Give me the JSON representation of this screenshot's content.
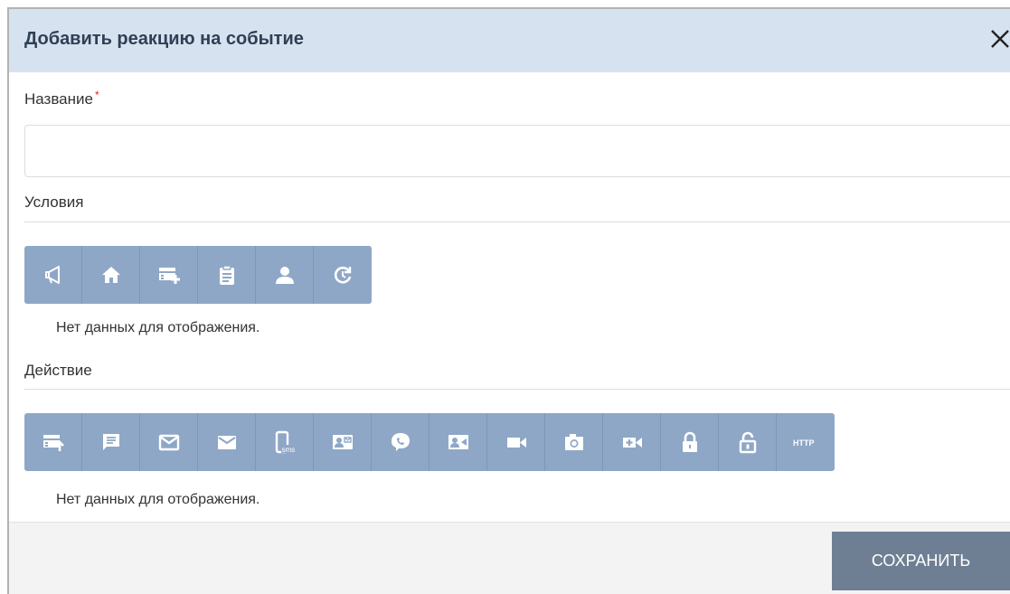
{
  "dialog": {
    "title": "Добавить реакцию на событие",
    "close_icon": "close-icon"
  },
  "form": {
    "name_label": "Название",
    "required_mark": "*",
    "name_value": "",
    "conditions_label": "Условия",
    "conditions_empty": "Нет данных для отображения.",
    "action_label": "Действие",
    "action_empty": "Нет данных для отображения."
  },
  "conditions_toolbar": [
    "megaphone-icon",
    "home-icon",
    "add-card-icon",
    "clipboard-icon",
    "user-icon",
    "schedule-icon"
  ],
  "actions_toolbar": [
    "card-upload-icon",
    "message-icon",
    "mail-outline-icon",
    "mail-filled-icon",
    "sms-icon",
    "contact-card-icon",
    "viber-icon",
    "video-contact-icon",
    "video-camera-icon",
    "photo-camera-icon",
    "add-video-icon",
    "lock-icon",
    "unlock-icon",
    "http-icon"
  ],
  "http_label": "HTTP",
  "sms_label": "sms",
  "footer": {
    "save_label": "СОХРАНИТЬ"
  },
  "colors": {
    "titlebar": "#d6e2ef",
    "toolbar": "#8ea7c6",
    "save_button": "#6f7f93",
    "required": "#e02020"
  }
}
